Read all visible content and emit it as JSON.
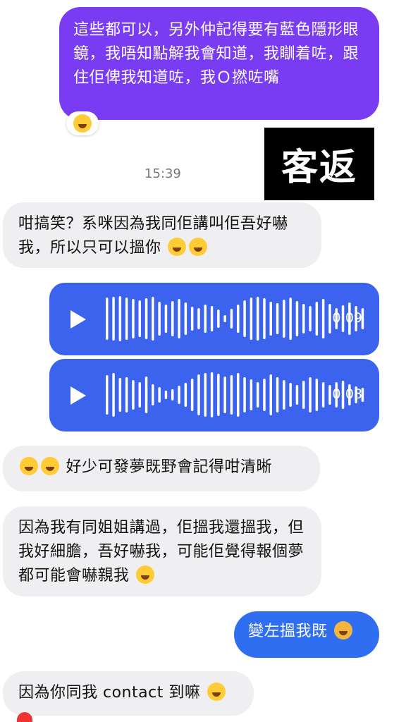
{
  "messages": {
    "m1": "這些都可以，另外仲記得要有藍色隱形眼鏡，我唔知點解我會知道，我瞓着咗，跟住佢俾我知道咗，我Ｏ撚咗嘴",
    "m2": "咁搞笑？系咪因為我同佢講叫佢吾好嚇我，所以只可以搵你",
    "m3": "好少可發夢既野會記得咁清晰",
    "m4": "因為我有同姐姐講過，佢搵我還搵我，但我好細膽，吾好嚇我，可能佢覺得報個夢都可能會嚇親我",
    "m5": "變左搵我既",
    "m6": "因為你同我 contact 到嘛"
  },
  "timestamp": "15:39",
  "badge_text": "客返",
  "voice": [
    {
      "duration": "0:09"
    },
    {
      "duration": "0:08"
    }
  ],
  "colors": {
    "outgoing_purple": "#7a3cf2",
    "outgoing_blue": "#2f6df1",
    "voice_blue": "#3b63ed",
    "incoming_gray": "#efeff2"
  },
  "icons": [
    "laugh-emoji",
    "rofl-emoji",
    "play-icon",
    "cat-laugh-emoji",
    "heart-icon"
  ]
}
